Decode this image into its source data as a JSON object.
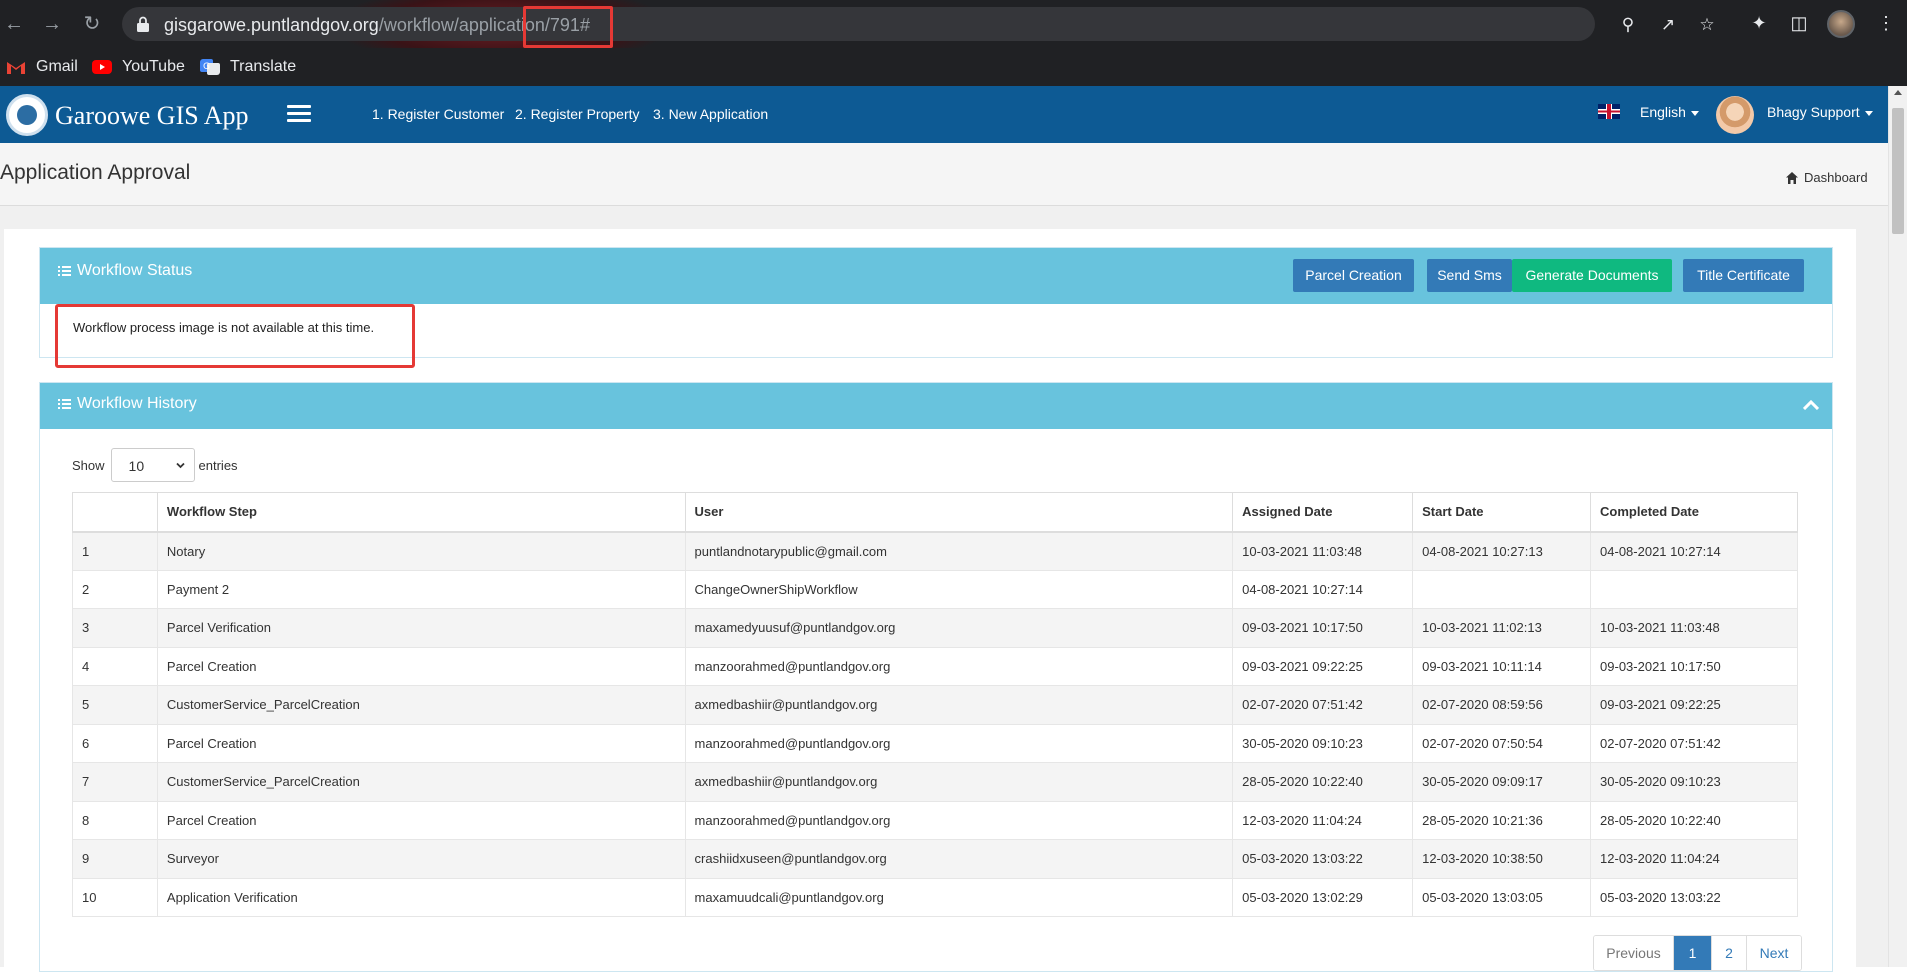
{
  "browser": {
    "url_host": "gisgarowe.puntlandgov.org",
    "url_path": "/workflow/application/791#",
    "bookmarks": [
      {
        "label": "Gmail",
        "icon": "gmail-icon"
      },
      {
        "label": "YouTube",
        "icon": "youtube-icon"
      },
      {
        "label": "Translate",
        "icon": "translate-icon"
      }
    ]
  },
  "navbar": {
    "app_title": "Garoowe GIS App",
    "links": [
      "1. Register Customer",
      "2. Register Property",
      "3. New Application"
    ],
    "language": "English",
    "user_name": "Bhagy Support"
  },
  "page": {
    "title": "Application Approval",
    "breadcrumb": "Dashboard"
  },
  "workflow_status": {
    "title": "Workflow Status",
    "buttons": {
      "parcel_creation": "Parcel Creation",
      "send_sms": "Send Sms",
      "generate_documents": "Generate Documents",
      "title_certificate": "Title Certificate"
    },
    "message": "Workflow process image is not available at this time."
  },
  "workflow_history": {
    "title": "Workflow History",
    "show_label": "Show",
    "entries_label": "entries",
    "page_size": "10",
    "columns": [
      "",
      "Workflow Step",
      "User",
      "Assigned Date",
      "Start Date",
      "Completed Date"
    ],
    "rows": [
      [
        "1",
        "Notary",
        "puntlandnotarypublic@gmail.com",
        "10-03-2021 11:03:48",
        "04-08-2021 10:27:13",
        "04-08-2021 10:27:14"
      ],
      [
        "2",
        "Payment 2",
        "ChangeOwnerShipWorkflow",
        "04-08-2021 10:27:14",
        "",
        ""
      ],
      [
        "3",
        "Parcel Verification",
        "maxamedyuusuf@puntlandgov.org",
        "09-03-2021 10:17:50",
        "10-03-2021 11:02:13",
        "10-03-2021 11:03:48"
      ],
      [
        "4",
        "Parcel Creation",
        "manzoorahmed@puntlandgov.org",
        "09-03-2021 09:22:25",
        "09-03-2021 10:11:14",
        "09-03-2021 10:17:50"
      ],
      [
        "5",
        "CustomerService_ParcelCreation",
        "axmedbashiir@puntlandgov.org",
        "02-07-2020 07:51:42",
        "02-07-2020 08:59:56",
        "09-03-2021 09:22:25"
      ],
      [
        "6",
        "Parcel Creation",
        "manzoorahmed@puntlandgov.org",
        "30-05-2020 09:10:23",
        "02-07-2020 07:50:54",
        "02-07-2020 07:51:42"
      ],
      [
        "7",
        "CustomerService_ParcelCreation",
        "axmedbashiir@puntlandgov.org",
        "28-05-2020 10:22:40",
        "30-05-2020 09:09:17",
        "30-05-2020 09:10:23"
      ],
      [
        "8",
        "Parcel Creation",
        "manzoorahmed@puntlandgov.org",
        "12-03-2020 11:04:24",
        "28-05-2020 10:21:36",
        "28-05-2020 10:22:40"
      ],
      [
        "9",
        "Surveyor",
        "crashiidxuseen@puntlandgov.org",
        "05-03-2020 13:03:22",
        "12-03-2020 10:38:50",
        "12-03-2020 11:04:24"
      ],
      [
        "10",
        "Application Verification",
        "maxamuudcali@puntlandgov.org",
        "05-03-2020 13:02:29",
        "05-03-2020 13:03:05",
        "05-03-2020 13:03:22"
      ]
    ],
    "pagination": {
      "previous": "Previous",
      "pages": [
        "1",
        "2"
      ],
      "current": "1",
      "next": "Next"
    }
  },
  "colors": {
    "navbar": "#0d5a94",
    "panel_header": "#68c3dd",
    "primary_button": "#337ab7",
    "success_button": "#0fb980",
    "annotation_highlight": "#e53935"
  }
}
